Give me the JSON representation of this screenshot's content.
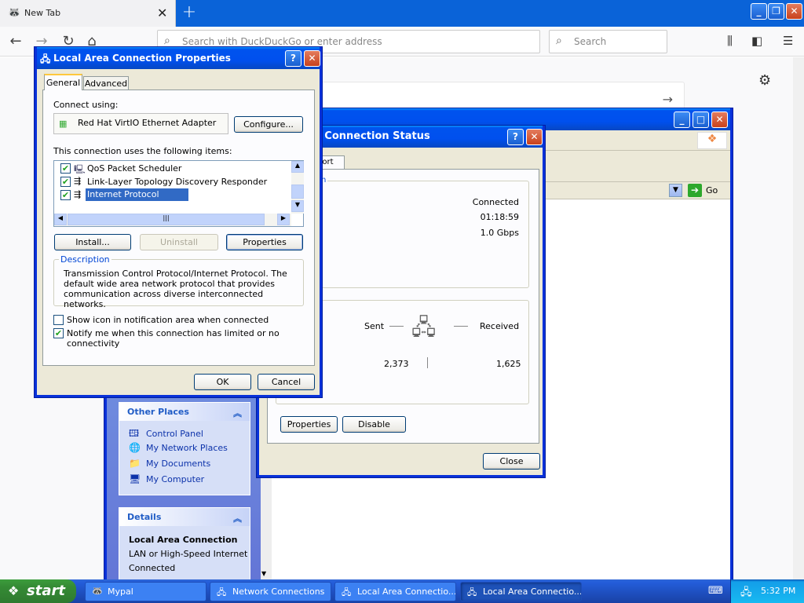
{
  "browser": {
    "tab_title": "New Tab",
    "url_placeholder": "Search with DuckDuckGo or enter address",
    "search_placeholder": "Search"
  },
  "nc_window": {
    "go_label": "Go",
    "other_places_title": "Other Places",
    "other_places": [
      "Control Panel",
      "My Network Places",
      "My Documents",
      "My Computer"
    ],
    "details_title": "Details",
    "details_name": "Local Area Connection",
    "details_type": "LAN or High-Speed Internet",
    "details_status": "Connected"
  },
  "status_dialog": {
    "title": "a Connection Status",
    "tab_partial": "port",
    "group_partial": "n",
    "status": "Connected",
    "duration": "01:18:59",
    "speed": "1.0 Gbps",
    "sent_label": "Sent",
    "received_label": "Received",
    "sent_value": "2,373",
    "received_value": "1,625",
    "properties_btn": "Properties",
    "disable_btn": "Disable",
    "close_btn": "Close"
  },
  "props_dialog": {
    "title": "Local Area Connection Properties",
    "tabs": [
      "General",
      "Advanced"
    ],
    "connect_using": "Connect using:",
    "adapter": "Red Hat VirtIO Ethernet Adapter",
    "configure_btn": "Configure...",
    "items_label": "This connection uses the following items:",
    "items": [
      "QoS Packet Scheduler",
      "Link-Layer Topology Discovery Responder",
      "Internet Protocol (TCP/IP)"
    ],
    "install_btn": "Install...",
    "uninstall_btn": "Uninstall",
    "properties_btn": "Properties",
    "description_title": "Description",
    "description": "Transmission Control Protocol/Internet Protocol. The default wide area network protocol that provides communication across diverse interconnected networks.",
    "show_icon": "Show icon in notification area when connected",
    "notify": "Notify me when this connection has limited or no connectivity",
    "ok_btn": "OK",
    "cancel_btn": "Cancel"
  },
  "taskbar": {
    "start": "start",
    "tasks": [
      "Mypal",
      "Network Connections",
      "Local Area Connectio...",
      "Local Area Connectio..."
    ],
    "clock": "5:32 PM"
  }
}
